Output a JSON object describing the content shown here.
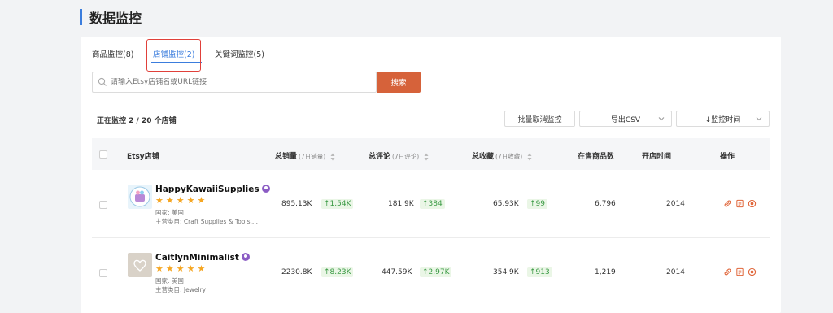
{
  "page": {
    "title": "数据监控"
  },
  "tabs": [
    {
      "label": "商品监控(8)",
      "active": false
    },
    {
      "label": "店铺监控(2)",
      "active": true
    },
    {
      "label": "关键词监控(5)",
      "active": false
    }
  ],
  "search": {
    "placeholder": "请输入Etsy店铺名或URL链接",
    "button": "搜索"
  },
  "toolbar": {
    "count_text": "正在监控 2 / 20 个店铺",
    "batch_cancel": "批量取消监控",
    "export_csv": "导出CSV",
    "sort_time": "↓监控时间"
  },
  "table": {
    "headers": {
      "shop": "Etsy店铺",
      "sales": "总销量",
      "sales_sub": "(7日销量)",
      "reviews": "总评论",
      "reviews_sub": "(7日评论)",
      "favorites": "总收藏",
      "favorites_sub": "(7日收藏)",
      "listings": "在售商品数",
      "opened": "开店时间",
      "actions": "操作"
    },
    "rows": [
      {
        "name": "HappyKawaiiSupplies",
        "rating": "★★★★★",
        "country": "国家: 美国",
        "category": "主营类目: Craft Supplies & Tools,...",
        "sales": "895.13K",
        "sales_inc": "↑1.54K",
        "reviews": "181.9K",
        "reviews_inc": "↑384",
        "favorites": "65.93K",
        "favorites_inc": "↑99",
        "listings": "6,796",
        "opened": "2014"
      },
      {
        "name": "CaitlynMinimalist",
        "rating": "★★★★★",
        "country": "国家: 美国",
        "category": "主营类目: Jewelry",
        "sales": "2230.8K",
        "sales_inc": "↑8.23K",
        "reviews": "447.59K",
        "reviews_inc": "↑2.97K",
        "favorites": "354.9K",
        "favorites_inc": "↑913",
        "listings": "1,219",
        "opened": "2014"
      }
    ]
  },
  "colors": {
    "accent": "#3b7ddd",
    "search_button": "#d6623a",
    "increase": "#3a9a44",
    "star": "#f5a623",
    "action_icon": "#e0663a",
    "highlight": "#e0403a"
  },
  "icons": [
    "search-icon",
    "chevron-down-icon",
    "sort-icon",
    "verified-badge-icon",
    "link-icon",
    "report-icon",
    "target-icon"
  ]
}
